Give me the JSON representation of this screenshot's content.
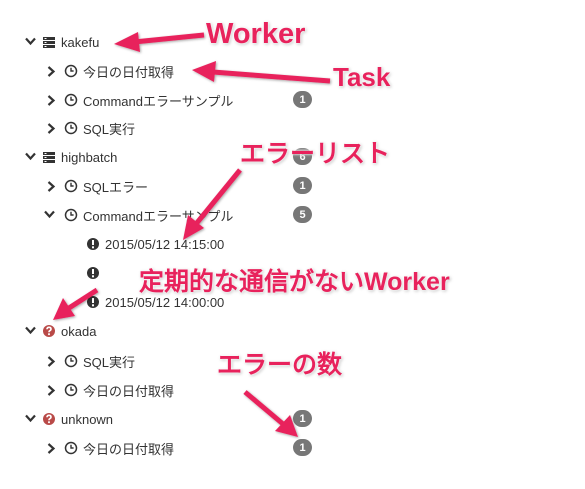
{
  "tree": {
    "workers": [
      {
        "name": "kakefu",
        "status": "server",
        "expanded": true,
        "count": null
      },
      {
        "name": "highbatch",
        "status": "server",
        "expanded": true,
        "count": "6"
      },
      {
        "name": "okada",
        "status": "warning",
        "expanded": true,
        "count": null
      },
      {
        "name": "unknown",
        "status": "warning",
        "expanded": true,
        "count": "1"
      }
    ],
    "tasks": [
      {
        "name": "今日の日付取得",
        "count": null
      },
      {
        "name": "Commandエラーサンプル",
        "count": "1"
      },
      {
        "name": "SQL実行",
        "count": null
      },
      {
        "name": "SQLエラー",
        "count": "1"
      },
      {
        "name": "Commandエラーサンプル",
        "count": "5"
      },
      {
        "name": "SQL実行",
        "count": null
      },
      {
        "name": "今日の日付取得",
        "count": null
      },
      {
        "name": "今日の日付取得",
        "count": "1"
      }
    ],
    "errors": [
      {
        "timestamp": "2015/05/12 14:15:00"
      },
      {
        "timestamp": "2015/05/12 14:00:00"
      }
    ]
  },
  "annotations": {
    "worker": "Worker",
    "task": "Task",
    "error_list": "エラーリスト",
    "no_contact_worker": "定期的な通信がないWorker",
    "error_count": "エラーの数"
  },
  "colors": {
    "annotation": "#e8225c",
    "badge": "#777777",
    "warning_icon": "#b94a48",
    "text": "#333333"
  },
  "icons": {
    "expanded": "chevron-down-icon",
    "collapsed": "chevron-right-icon",
    "worker": "server-icon",
    "worker_warning": "question-circle-icon",
    "task": "clock-icon",
    "error": "exclamation-circle-icon"
  }
}
